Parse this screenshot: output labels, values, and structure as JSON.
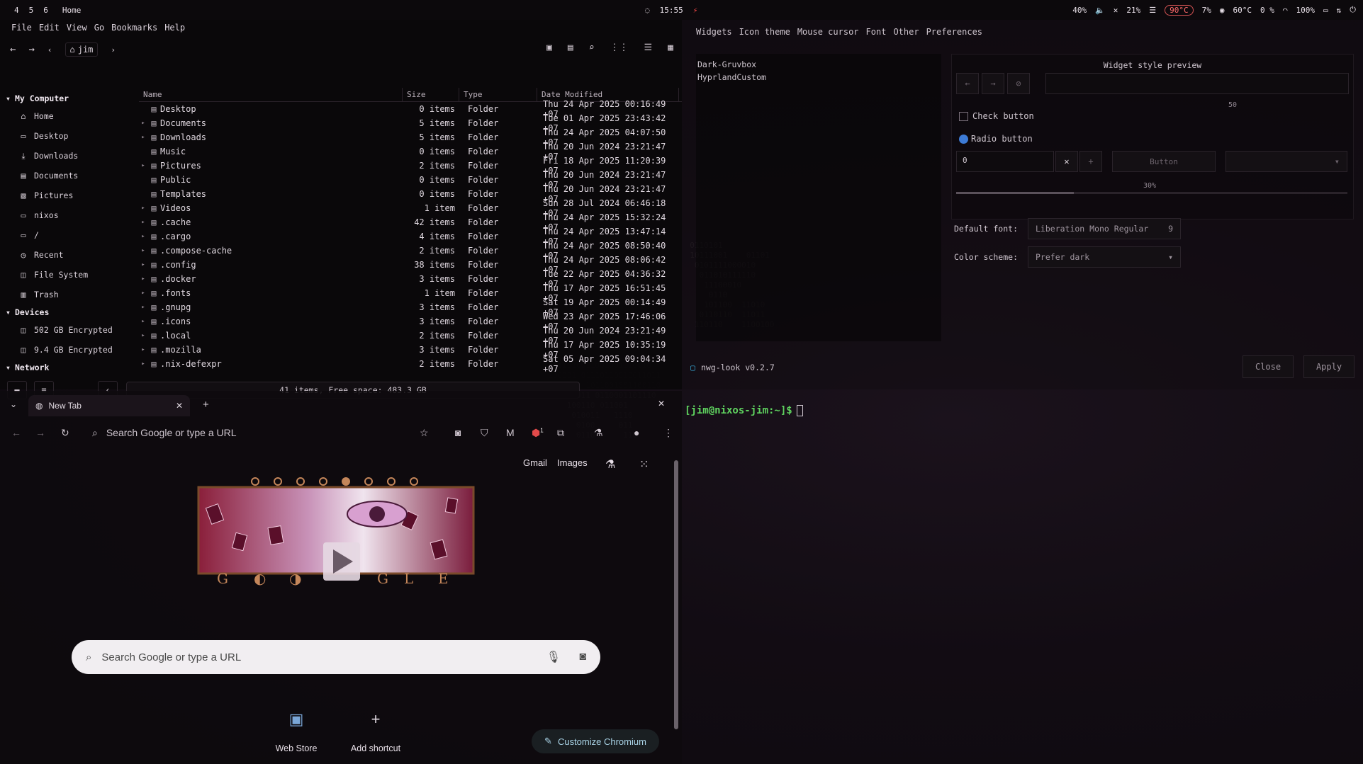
{
  "topbar": {
    "workspaces": [
      "4",
      "5",
      "6"
    ],
    "active_title": "Home",
    "time": "15:55",
    "stats": [
      "40%",
      "21%",
      "90°C",
      "7%",
      "60°C",
      "0 %",
      "100%"
    ]
  },
  "file_manager": {
    "menu": [
      "File",
      "Edit",
      "View",
      "Go",
      "Bookmarks",
      "Help"
    ],
    "breadcrumb": "jim",
    "sidebar": {
      "my_computer_label": "My Computer",
      "my_computer": [
        {
          "label": "Home",
          "icon": "home-icon"
        },
        {
          "label": "Desktop",
          "icon": "folder-icon"
        },
        {
          "label": "Downloads",
          "icon": "download-icon"
        },
        {
          "label": "Documents",
          "icon": "document-icon"
        },
        {
          "label": "Pictures",
          "icon": "picture-icon"
        },
        {
          "label": "nixos",
          "icon": "folder-icon"
        },
        {
          "label": "/",
          "icon": "folder-icon"
        },
        {
          "label": "Recent",
          "icon": "recent-icon"
        },
        {
          "label": "File System",
          "icon": "drive-icon"
        },
        {
          "label": "Trash",
          "icon": "trash-icon"
        }
      ],
      "devices_label": "Devices",
      "devices": [
        {
          "label": "502 GB Encrypted",
          "icon": "drive-icon"
        },
        {
          "label": "9.4 GB Encrypted",
          "icon": "drive-icon"
        }
      ],
      "network_label": "Network"
    },
    "columns": [
      "Name",
      "Size",
      "Type",
      "Date Modified"
    ],
    "rows": [
      {
        "name": "Desktop",
        "size": "0 items",
        "type": "Folder",
        "date": "Thu 24 Apr 2025 00:16:49 +07",
        "exp": false
      },
      {
        "name": "Documents",
        "size": "5 items",
        "type": "Folder",
        "date": "Tue 01 Apr 2025 23:43:42 +07",
        "exp": true
      },
      {
        "name": "Downloads",
        "size": "5 items",
        "type": "Folder",
        "date": "Thu 24 Apr 2025 04:07:50 +07",
        "exp": true
      },
      {
        "name": "Music",
        "size": "0 items",
        "type": "Folder",
        "date": "Thu 20 Jun 2024 23:21:47 +07",
        "exp": false
      },
      {
        "name": "Pictures",
        "size": "2 items",
        "type": "Folder",
        "date": "Fri 18 Apr 2025 11:20:39 +07",
        "exp": true
      },
      {
        "name": "Public",
        "size": "0 items",
        "type": "Folder",
        "date": "Thu 20 Jun 2024 23:21:47 +07",
        "exp": false
      },
      {
        "name": "Templates",
        "size": "0 items",
        "type": "Folder",
        "date": "Thu 20 Jun 2024 23:21:47 +07",
        "exp": false
      },
      {
        "name": "Videos",
        "size": "1 item",
        "type": "Folder",
        "date": "Sun 28 Jul 2024 06:46:18 +07",
        "exp": true
      },
      {
        "name": ".cache",
        "size": "42 items",
        "type": "Folder",
        "date": "Thu 24 Apr 2025 15:32:24 +07",
        "exp": true
      },
      {
        "name": ".cargo",
        "size": "4 items",
        "type": "Folder",
        "date": "Thu 24 Apr 2025 13:47:14 +07",
        "exp": true
      },
      {
        "name": ".compose-cache",
        "size": "2 items",
        "type": "Folder",
        "date": "Thu 24 Apr 2025 08:50:40 +07",
        "exp": true
      },
      {
        "name": ".config",
        "size": "38 items",
        "type": "Folder",
        "date": "Thu 24 Apr 2025 08:06:42 +07",
        "exp": true
      },
      {
        "name": ".docker",
        "size": "3 items",
        "type": "Folder",
        "date": "Tue 22 Apr 2025 04:36:32 +07",
        "exp": true
      },
      {
        "name": ".fonts",
        "size": "1 item",
        "type": "Folder",
        "date": "Thu 17 Apr 2025 16:51:45 +07",
        "exp": true
      },
      {
        "name": ".gnupg",
        "size": "3 items",
        "type": "Folder",
        "date": "Sat 19 Apr 2025 00:14:49 +07",
        "exp": true
      },
      {
        "name": ".icons",
        "size": "3 items",
        "type": "Folder",
        "date": "Wed 23 Apr 2025 17:46:06 +07",
        "exp": true
      },
      {
        "name": ".local",
        "size": "2 items",
        "type": "Folder",
        "date": "Thu 20 Jun 2024 23:21:49 +07",
        "exp": true
      },
      {
        "name": ".mozilla",
        "size": "3 items",
        "type": "Folder",
        "date": "Thu 17 Apr 2025 10:35:19 +07",
        "exp": true
      },
      {
        "name": ".nix-defexpr",
        "size": "2 items",
        "type": "Folder",
        "date": "Sat 05 Apr 2025 09:04:34 +07",
        "exp": true
      }
    ],
    "status": "41 items, Free space: 483.3 GB"
  },
  "nwg": {
    "tabs": [
      "Widgets",
      "Icon theme",
      "Mouse cursor",
      "Font",
      "Other",
      "Preferences"
    ],
    "themes": [
      "Dark-Gruvbox",
      "HyprlandCustom"
    ],
    "preview_title": "Widget style preview",
    "scale_value": "50",
    "check_label": "Check button",
    "radio_label": "Radio button",
    "spin_value": "0",
    "button_label": "Button",
    "progress_label": "30%",
    "progress": 0.3,
    "default_font_label": "Default font:",
    "default_font_value": "Liberation Mono Regular",
    "default_font_size": "9",
    "color_scheme_label": "Color scheme:",
    "color_scheme_value": "Prefer dark",
    "close_label": "Close",
    "apply_label": "Apply",
    "app_title": "nwg-look v0.2.7"
  },
  "terminal": {
    "prompt": "[jim@nixos-jim:~]$"
  },
  "browser": {
    "tab_title": "New Tab",
    "address_placeholder": "Search Google or type a URL",
    "links": [
      "Gmail",
      "Images"
    ],
    "doodle_letters": "G · ◐ · ◑ · G L · E",
    "search_placeholder": "Search Google or type a URL",
    "shortcuts": [
      {
        "label": "Web Store",
        "icon": "webstore-icon"
      },
      {
        "label": "Add shortcut",
        "icon": "plus-icon"
      }
    ],
    "customize_label": "Customize Chromium",
    "extension_badge": "1"
  }
}
